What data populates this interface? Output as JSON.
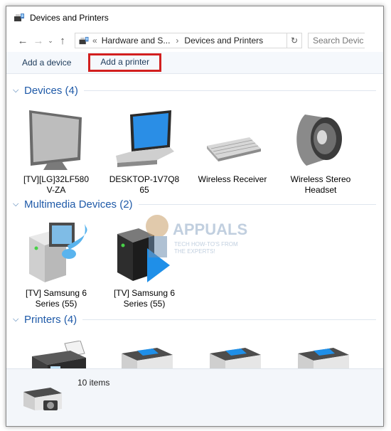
{
  "window": {
    "title": "Devices and Printers"
  },
  "address": {
    "overflow": "«",
    "crumbs": [
      "Hardware and S...",
      "Devices and Printers"
    ],
    "search_placeholder": "Search Devic"
  },
  "toolbar": {
    "add_device": "Add a device",
    "add_printer": "Add a printer"
  },
  "groups": {
    "devices": {
      "title": "Devices (4)",
      "items": [
        {
          "label_1": "[TV][LG]32LF580",
          "label_2": "V-ZA",
          "icon": "tv-icon"
        },
        {
          "label_1": "DESKTOP-1V7Q8",
          "label_2": "65",
          "icon": "laptop-icon"
        },
        {
          "label_1": "Wireless Receiver",
          "label_2": "",
          "icon": "keyboard-icon"
        },
        {
          "label_1": "Wireless Stereo",
          "label_2": "Headset",
          "icon": "speaker-icon"
        }
      ]
    },
    "multimedia": {
      "title": "Multimedia Devices (2)",
      "items": [
        {
          "label_1": "[TV] Samsung 6",
          "label_2": "Series (55)",
          "icon": "media-server-icon"
        },
        {
          "label_1": "[TV] Samsung 6",
          "label_2": "Series (55)",
          "icon": "media-renderer-icon"
        }
      ]
    },
    "printers": {
      "title": "Printers (4)"
    }
  },
  "watermark": {
    "brand": "APPUALS",
    "tagline_1": "TECH HOW-TO'S FROM",
    "tagline_2": "THE EXPERTS!"
  },
  "status": {
    "count": "10 items"
  },
  "colors": {
    "accent": "#1f5aa8",
    "highlight": "#d21f1f"
  }
}
